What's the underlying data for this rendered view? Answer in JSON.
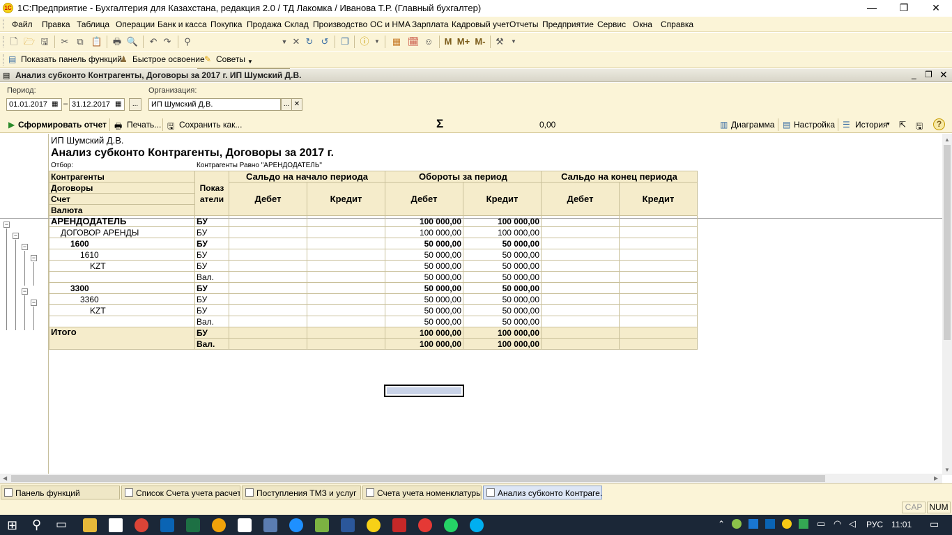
{
  "window": {
    "title": "1С:Предприятие - Бухгалтерия для Казахстана, редакция 2.0 / ТД Лакомка / Иванова Т.Р. (Главный бухгалтер)",
    "logo": "1С",
    "minimize": "—",
    "maximize": "❐",
    "close": "✕"
  },
  "menu": [
    "Файл",
    "Правка",
    "Таблица",
    "Операции",
    "Банк и касса",
    "Покупка",
    "Продажа",
    "Склад",
    "Производство",
    "ОС и НМА",
    "Зарплата",
    "Кадровый учет",
    "Отчеты",
    "Предприятие",
    "Сервис",
    "Окна",
    "Справка"
  ],
  "toolbar1": {
    "m": "M",
    "mplus": "M+",
    "mminus": "M-"
  },
  "toolbar2": {
    "show_panel": "Показать панель функций",
    "quick_learn": "Быстрое освоение",
    "tips": "Советы"
  },
  "document": {
    "title": "Анализ субконто Контрагенты, Договоры за 2017 г. ИП Шумский Д.В."
  },
  "params": {
    "period_label": "Период:",
    "date_from": "01.01.2017",
    "date_sep": "–",
    "date_to": "31.12.2017",
    "ellipsis": "...",
    "org_label": "Организация:",
    "org_value": "ИП Шумский Д.В."
  },
  "commands": {
    "generate": "Сформировать отчет",
    "print": "Печать...",
    "save": "Сохранить как...",
    "sum_value": "0,00",
    "diagram": "Диаграмма",
    "settings": "Настройка",
    "history": "История",
    "help": "?"
  },
  "report": {
    "org": "ИП Шумский Д.В.",
    "heading": "Анализ субконто Контрагенты, Договоры за 2017 г.",
    "filter_label": "Отбор:",
    "filter_value": "Контрагенты Равно \"АРЕНДОДАТЕЛЬ\"",
    "header": {
      "contractors": "Контрагенты",
      "contracts": "Договоры",
      "account": "Счет",
      "currency": "Валюта",
      "indicators": "Показ\nатели",
      "opening": "Сальдо на начало периода",
      "turnover": "Обороты за период",
      "closing": "Сальдо на конец периода",
      "debit": "Дебет",
      "credit": "Кредит"
    },
    "rows": [
      {
        "name": "АРЕНДОДАТЕЛЬ",
        "indent": 0,
        "bold": true,
        "ind": "БУ",
        "td": "100 000,00",
        "tc": "100 000,00"
      },
      {
        "name": "ДОГОВОР АРЕНДЫ",
        "indent": 1,
        "bold": false,
        "ind": "БУ",
        "td": "100 000,00",
        "tc": "100 000,00"
      },
      {
        "name": "1600",
        "indent": 2,
        "bold": true,
        "ind": "БУ",
        "td": "50 000,00",
        "tc": "50 000,00"
      },
      {
        "name": "1610",
        "indent": 3,
        "bold": false,
        "ind": "БУ",
        "td": "50 000,00",
        "tc": "50 000,00"
      },
      {
        "name": "KZT",
        "indent": 4,
        "bold": false,
        "ind": "БУ",
        "td": "50 000,00",
        "tc": "50 000,00"
      },
      {
        "name": "",
        "indent": 4,
        "bold": false,
        "ind": "Вал.",
        "td": "50 000,00",
        "tc": "50 000,00"
      },
      {
        "name": "3300",
        "indent": 2,
        "bold": true,
        "ind": "БУ",
        "td": "50 000,00",
        "tc": "50 000,00"
      },
      {
        "name": "3360",
        "indent": 3,
        "bold": false,
        "ind": "БУ",
        "td": "50 000,00",
        "tc": "50 000,00"
      },
      {
        "name": "KZT",
        "indent": 4,
        "bold": false,
        "ind": "БУ",
        "td": "50 000,00",
        "tc": "50 000,00"
      },
      {
        "name": "",
        "indent": 4,
        "bold": false,
        "ind": "Вал.",
        "td": "50 000,00",
        "tc": "50 000,00"
      }
    ],
    "total": {
      "label": "Итого",
      "rows": [
        {
          "ind": "БУ",
          "td": "100 000,00",
          "tc": "100 000,00"
        },
        {
          "ind": "Вал.",
          "td": "100 000,00",
          "tc": "100 000,00"
        }
      ]
    }
  },
  "tabs": [
    "Панель функций",
    "Список Счета учета расчет...",
    "Поступления ТМЗ и услуг",
    "Счета учета номенклатуры",
    "Анализ субконто Контраге..."
  ],
  "status": {
    "cap": "CAP",
    "num": "NUM"
  },
  "taskbar": {
    "lang": "РУС",
    "time": "11:01"
  },
  "colors": {
    "panel": "#fbf4d7",
    "header_cell": "#f5eccb",
    "grid": "#c9c09a",
    "taskbar": "#1b2737"
  }
}
